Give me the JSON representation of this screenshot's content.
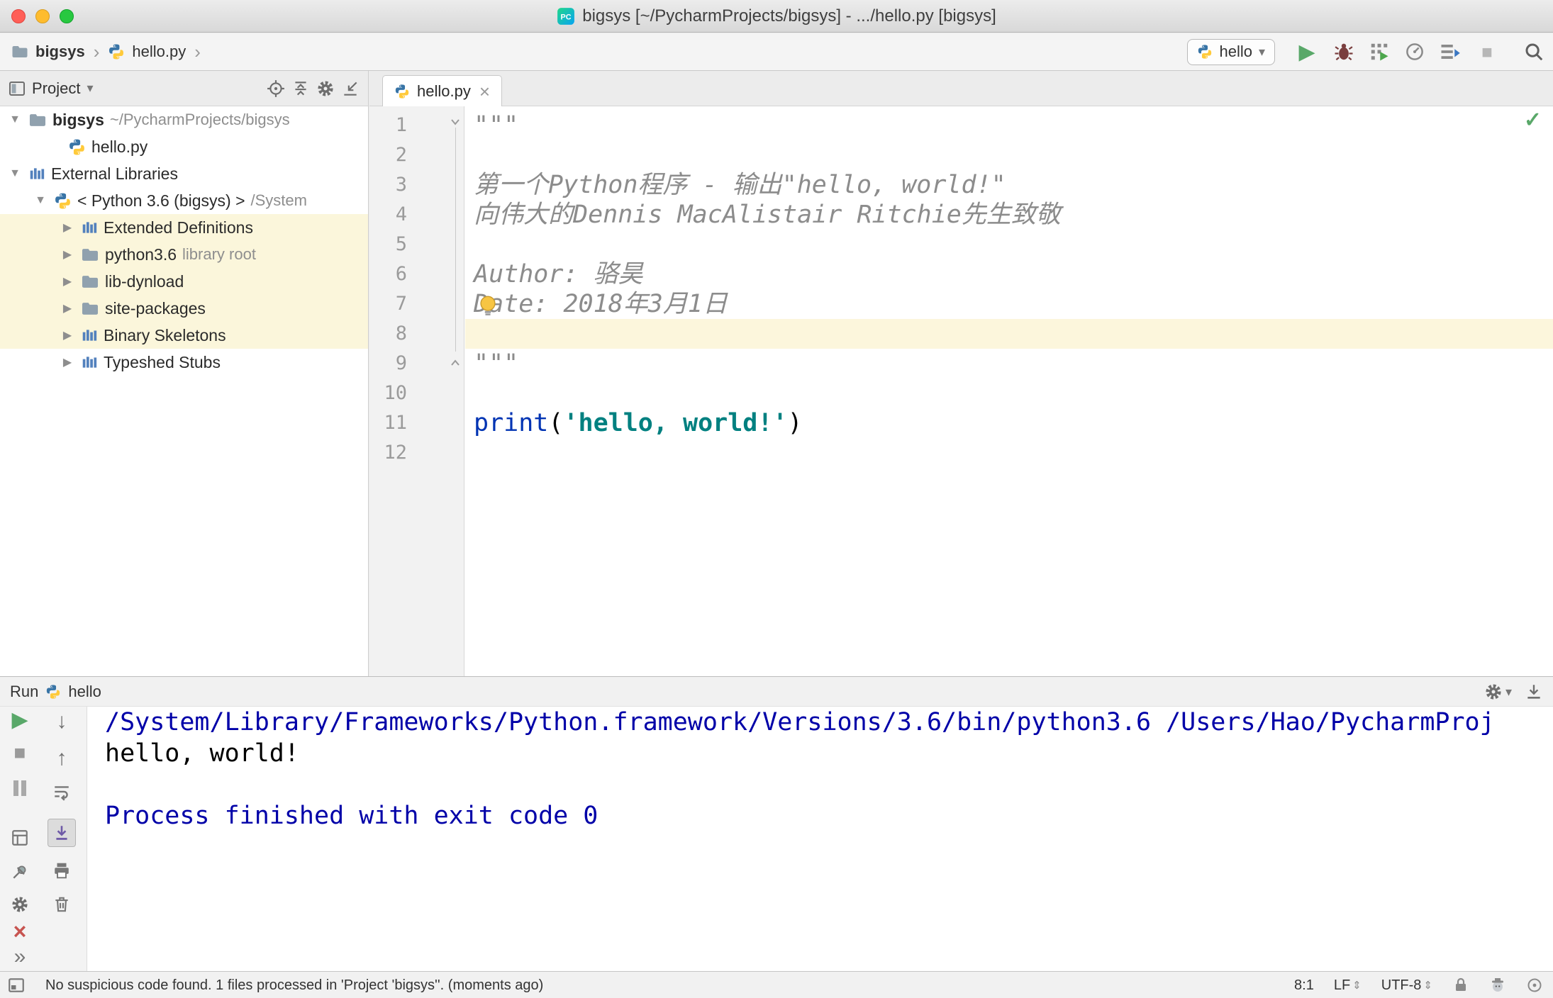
{
  "colors": {
    "accent_run_green": "#59A869",
    "error_red": "#C75450",
    "string_teal": "#008080",
    "function_blue": "#0033B3",
    "comment_gray": "#8C8C8C",
    "console_navy": "#0000A8",
    "caret_line_yellow": "#FCF6DC",
    "library_row_yellow": "#FBF6DB"
  },
  "icons": {
    "chevron": "›",
    "caret_down": "▾",
    "tree_open": "▼",
    "tree_closed": "▶",
    "play": "▶",
    "stop": "■",
    "close": "×",
    "more": "»",
    "arrow_up": "↑",
    "arrow_down": "↓",
    "updown_arrows": "⇕",
    "check": "✓"
  },
  "titlebar": {
    "title": "bigsys [~/PycharmProjects/bigsys] - .../hello.py [bigsys]"
  },
  "navbar": {
    "breadcrumb_project": "bigsys",
    "breadcrumb_file": "hello.py",
    "run_config": "hello"
  },
  "project_panel": {
    "title": "Project",
    "tree": [
      {
        "label": "bigsys",
        "sublabel": "~/PycharmProjects/bigsys"
      },
      {
        "label": "hello.py",
        "sublabel": ""
      },
      {
        "label": "External Libraries",
        "sublabel": ""
      },
      {
        "label": "< Python 3.6 (bigsys) >",
        "sublabel": "/System"
      },
      {
        "label": "Extended Definitions",
        "sublabel": ""
      },
      {
        "label": "python3.6",
        "sublabel": "library root"
      },
      {
        "label": "lib-dynload",
        "sublabel": ""
      },
      {
        "label": "site-packages",
        "sublabel": ""
      },
      {
        "label": "Binary Skeletons",
        "sublabel": ""
      },
      {
        "label": "Typeshed Stubs",
        "sublabel": ""
      }
    ]
  },
  "editor": {
    "tab_title": "hello.py",
    "line_numbers": [
      "1",
      "2",
      "3",
      "4",
      "5",
      "6",
      "7",
      "8",
      "9",
      "10",
      "11",
      "12"
    ],
    "code": {
      "l1": "\"\"\"",
      "l3": "第一个Python程序 - 输出\"hello, world!\"",
      "l4": "向伟大的Dennis MacAlistair Ritchie先生致敬",
      "l6": "Author: 骆昊",
      "l7": "Date: 2018年3月1日",
      "l9": "\"\"\"",
      "l11_func": "print",
      "l11_paren_open": "(",
      "l11_string": "'hello, world!'",
      "l11_paren_close": ")"
    }
  },
  "run_panel": {
    "title": "Run",
    "config_name": "hello",
    "console_line1": "/System/Library/Frameworks/Python.framework/Versions/3.6/bin/python3.6 /Users/Hao/PycharmProj",
    "console_line2": "hello, world!",
    "console_line4": "Process finished with exit code 0"
  },
  "statusbar": {
    "message": "No suspicious code found. 1 files processed in 'Project 'bigsys''. (moments ago)",
    "caret_position": "8:1",
    "line_separator": "LF",
    "encoding": "UTF-8"
  }
}
